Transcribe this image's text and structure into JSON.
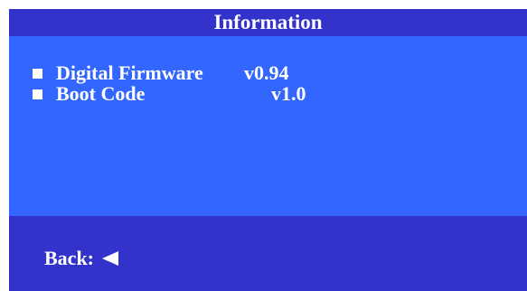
{
  "header": {
    "title": "Information"
  },
  "info": {
    "items": [
      {
        "icon": "bullet-square-icon",
        "label": "Digital Firmware",
        "value": "v0.94"
      },
      {
        "icon": "bullet-square-icon",
        "label": "Boot Code",
        "value": "v1.0"
      }
    ]
  },
  "footer": {
    "back_label": "Back:",
    "back_icon": "left-triangle-arrow-icon"
  },
  "colors": {
    "panel_background": "#3366ff",
    "title_bar": "#3333cc",
    "footer_bar": "#3333cc",
    "text": "#ffffff"
  }
}
